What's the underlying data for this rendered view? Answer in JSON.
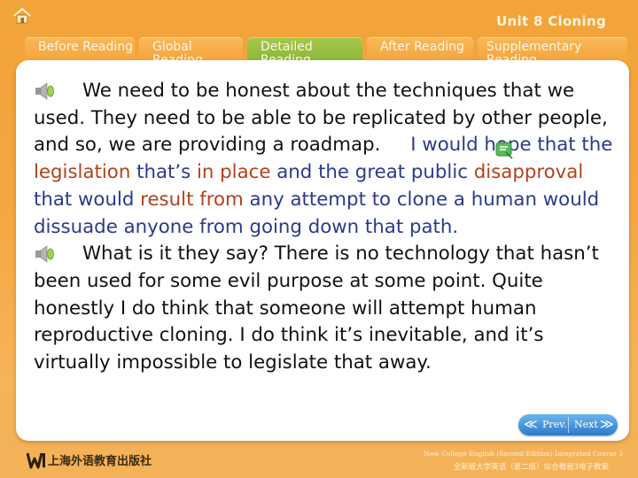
{
  "header": {
    "unit_title": "Unit 8 Cloning"
  },
  "tabs": [
    {
      "label": "Before Reading",
      "active": false
    },
    {
      "label": "Global Reading",
      "active": false
    },
    {
      "label": "Detailed Reading",
      "active": true
    },
    {
      "label": "After Reading",
      "active": false
    },
    {
      "label": "Supplementary Reading",
      "active": false
    }
  ],
  "paragraphs": [
    {
      "icon": "speaker-icon",
      "line1": "We need to be honest about the techniques",
      "rest": "that we used. They need to be able to be replicated by other people, and so, we are providing a roadmap.",
      "segments": [
        {
          "text": "I would hope that the ",
          "style": "blue"
        },
        {
          "text": "legislation",
          "style": "red"
        },
        {
          "text": " that’s ",
          "style": "blue"
        },
        {
          "text": "in place",
          "style": "red"
        },
        {
          "text": " and the great public ",
          "style": "blue"
        },
        {
          "text": "disapproval",
          "style": "red"
        },
        {
          "text": " that would ",
          "style": "blue"
        },
        {
          "text": "result from",
          "style": "red"
        },
        {
          "text": " any attempt to clone a human would dissuade anyone from going down that path.",
          "style": "blue"
        }
      ]
    },
    {
      "icon": "speaker-icon",
      "line1": "What is it they say? There is no technology that",
      "rest": "hasn’t been used for some evil purpose at some point. Quite honestly I do think that someone will attempt human reproductive cloning. I do think it’s inevitable, and it’s virtually impossible to legislate that away."
    }
  ],
  "nav": {
    "prev_label": "Prev.",
    "next_label": "Next",
    "prev_chevron": "≪",
    "next_chevron": "≫"
  },
  "footer": {
    "publisher": "上海外语教育出版社",
    "english": "New College English (Second Edition) Integrated Course 3",
    "chinese": "全新版大学英语（第二版）综合教程3电子教案"
  },
  "colors": {
    "highlight_blue": "#2b3a8c",
    "highlight_red": "#b3421a",
    "active_tab": "#8fbb3c",
    "tab": "#f5a23a",
    "nav_button": "#3f8ad6"
  }
}
